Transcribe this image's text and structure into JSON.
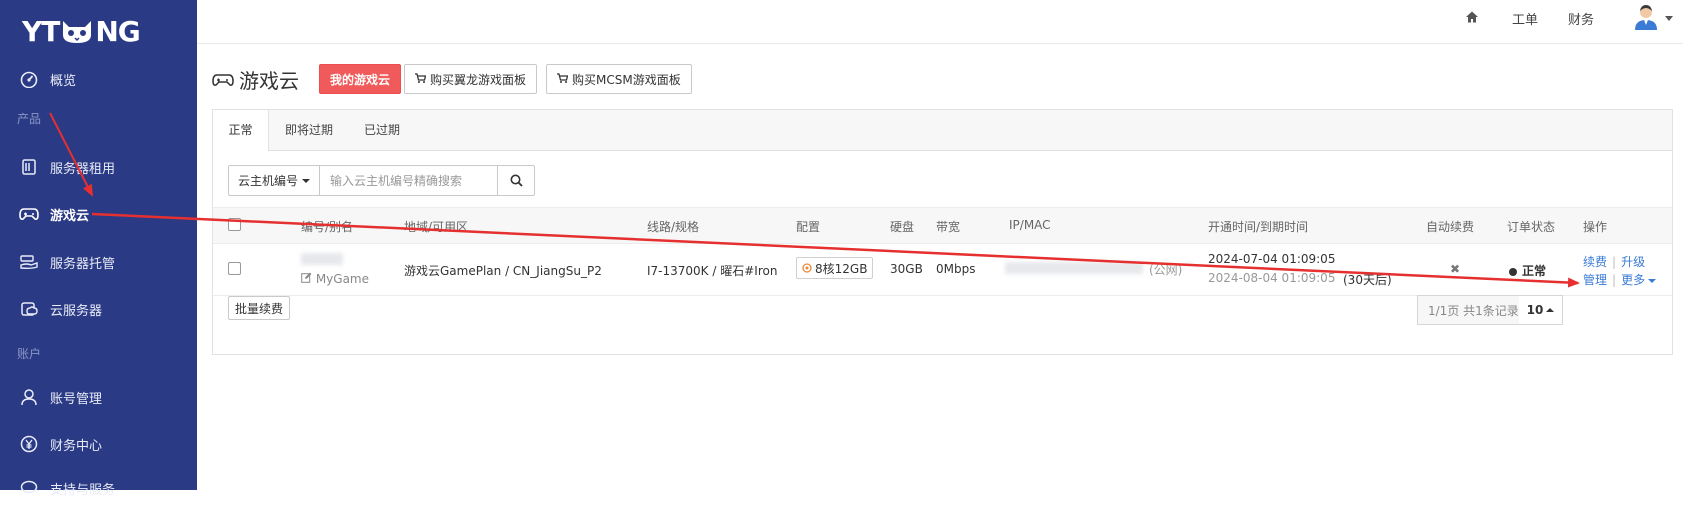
{
  "brand": {
    "logo_text_left": "YT",
    "logo_text_right": "NG"
  },
  "sidebar": {
    "items": [
      {
        "label": "概览",
        "icon": "dashboard-icon"
      },
      {
        "label": "服务器租用",
        "icon": "server-icon"
      },
      {
        "label": "游戏云",
        "icon": "gamepad-icon"
      },
      {
        "label": "服务器托管",
        "icon": "hosting-icon"
      },
      {
        "label": "云服务器",
        "icon": "cloud-icon"
      },
      {
        "label": "账号管理",
        "icon": "user-icon"
      },
      {
        "label": "财务中心",
        "icon": "yen-icon"
      },
      {
        "label": "支持与服务",
        "icon": "chat-icon"
      }
    ],
    "sections": {
      "products": "产品",
      "account": "账户"
    }
  },
  "topbar": {
    "tickets": "工单",
    "finance": "财务"
  },
  "header": {
    "title": "游戏云",
    "my_game_cloud_btn": "我的游戏云",
    "buy_yilong_btn": "购买翼龙游戏面板",
    "buy_mcsm_btn": "购买MCSM游戏面板"
  },
  "tabs": {
    "normal": "正常",
    "expiring": "即将过期",
    "expired": "已过期"
  },
  "search": {
    "filter_label": "云主机编号",
    "placeholder": "输入云主机编号精确搜索"
  },
  "table": {
    "headers": {
      "id_alias": "编号/别名",
      "region": "地域/可用区",
      "line_spec": "线路/规格",
      "config": "配置",
      "disk": "硬盘",
      "bandwidth": "带宽",
      "ip_mac": "IP/MAC",
      "time": "开通时间/到期时间",
      "auto_renew": "自动续费",
      "order_status": "订单状态",
      "actions": "操作"
    },
    "rows": [
      {
        "alias": "MyGame",
        "region": "游戏云GamePlan / CN_JiangSu_P2",
        "line_spec": "I7-13700K / 曜石#Iron",
        "config": "8核12GB",
        "disk": "30GB",
        "bandwidth": "0Mbps",
        "ip_suffix": "(公网)",
        "open_time": "2024-07-04 01:09:05",
        "expire_time": "2024-08-04 01:09:05",
        "remaining": "(30天后)",
        "auto_renew": "✖",
        "status": "正常",
        "action_renew": "续费",
        "action_upgrade": "升级",
        "action_manage": "管理",
        "action_more": "更多"
      }
    ]
  },
  "footer": {
    "bulk_renew": "批量续费",
    "pager_info": "1/1页 共1条记录",
    "page_size": "10"
  },
  "colors": {
    "sidebar_bg": "#2b3a85",
    "primary_button": "#f05a5a",
    "link": "#3a7bd5",
    "annotation_arrow": "#e63030"
  }
}
